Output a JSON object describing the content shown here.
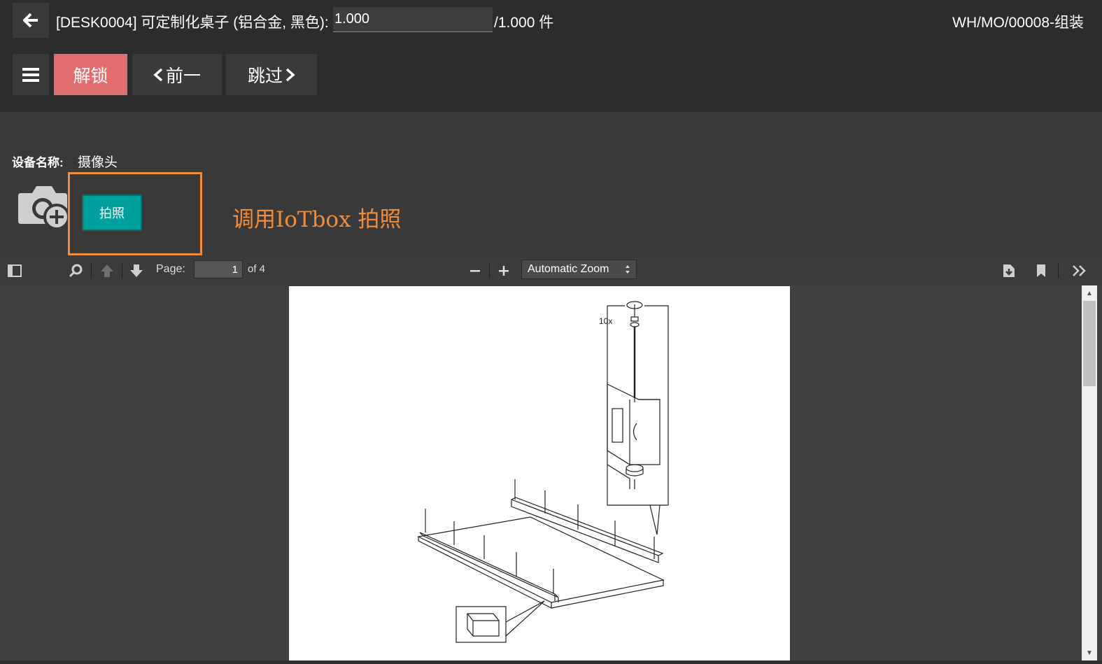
{
  "header": {
    "title": "[DESK0004] 可定制化桌子 (铝合金, 黑色):",
    "qty_done": "1.000",
    "qty_total": "/1.000 件",
    "mo_ref": "WH/MO/00008-组装"
  },
  "actions": {
    "unlock_label": "解锁",
    "prev_label": "前一",
    "skip_label": "跳过"
  },
  "device": {
    "label": "设备名称:",
    "value": "摄像头",
    "photo_button": "拍照",
    "annotation": "调用IoTbox 拍照"
  },
  "pdf_toolbar": {
    "page_label": "Page:",
    "page_value": "1",
    "page_of": "of 4",
    "zoom_label": "Automatic Zoom"
  },
  "pdf_content": {
    "quantity_callout": "10x"
  },
  "colors": {
    "unlock": "#e06e6e",
    "photo_button": "#00a09d",
    "highlight": "#f08c3a"
  }
}
